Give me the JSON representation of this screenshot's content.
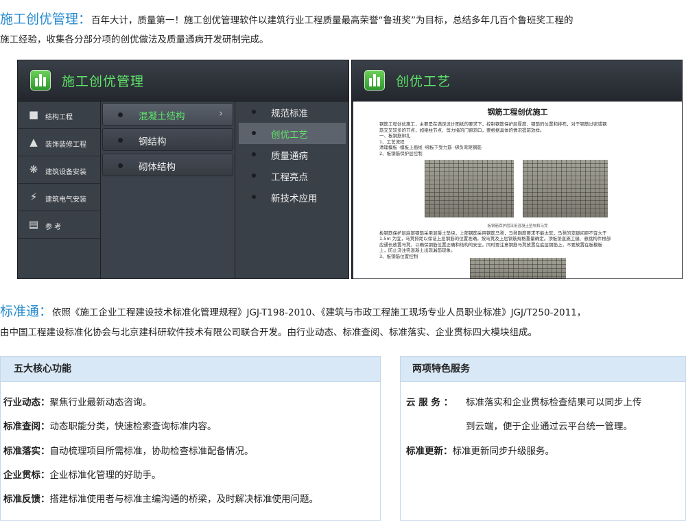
{
  "intro": {
    "title": "施工创优管理：",
    "text_line1": "百年大计，质量第一！施工创优管理软件以建筑行业工程质量最高荣誉“鲁班奖”为目标，总结多年几百个鲁班奖工程的",
    "text_line2": "施工经验，收集各分部分项的创优做法及质量通病开发研制完成。"
  },
  "left_screen": {
    "title": "施工创优管理",
    "col1": [
      {
        "icon": "building-icon",
        "label": "结构工程"
      },
      {
        "icon": "decoration-icon",
        "label": "装饰装修工程"
      },
      {
        "icon": "equipment-icon",
        "label": "建筑设备安装"
      },
      {
        "icon": "electric-icon",
        "label": "建筑电气安装"
      },
      {
        "icon": "reference-icon",
        "label": "参  考"
      }
    ],
    "col2": [
      {
        "label": "混凝土结构",
        "active": true
      },
      {
        "label": "钢结构",
        "active": false
      },
      {
        "label": "砌体结构",
        "active": false
      }
    ],
    "col2_arrow": "›",
    "col3": [
      {
        "label": "规范标准",
        "active": false
      },
      {
        "label": "创优工艺",
        "active": true
      },
      {
        "label": "质量通病",
        "active": false
      },
      {
        "label": "工程亮点",
        "active": false
      },
      {
        "label": "新技术应用",
        "active": false
      }
    ]
  },
  "right_screen": {
    "title": "创优工艺",
    "doc_title": "钢筋工程创优施工",
    "doc_p1": [
      "钢筋工程创优施工，主要是在满足设计图纸的要求下，控制钢筋保护层厚度、钢筋的位置和排布，对于钢筋过密或钢",
      "筋交叉较多的节点，如梁柱节点、剪力墙的门窗洞口，要根据具体的情况提前放样。",
      "一、板钢筋绑扎",
      "1、工艺流程",
      "清理模板  ·模板上画线  ·绑板下受力筋  ·绑负弯矩钢筋",
      "2、板钢筋保护层控制"
    ],
    "photo_caption": "板钢筋保护层采用混凝土垫块和马凳",
    "doc_p2": [
      "板钢筋保护层底部钢筋采用混凝土垫块，上部钢筋采用钢筋马凳，马凳刚度要求不能太软，马凳的支腿间距不宜大于",
      "1.5m 为宜，马凳排距以保证上层钢筋的位置准确，按马凳及上层钢筋规格重量确定。顶板垫直施工缝、悬挑构件根部",
      "应通长放置马凳，以确保钢筋位置正确和结构的安全。同时要注意钢筋马凳放置在底层钢筋上，不要放置在板模板",
      "上，防止浇注完混凝土出现漏筋现象。",
      "3、板钢筋位置控制"
    ]
  },
  "section2": {
    "title": "标准通：",
    "text_line1": "依照《施工企业工程建设技术标准化管理规程》JGJ-T198-2010、《建筑与市政工程施工现场专业人员职业标准》JGJ/T250-2011，",
    "text_line2": "由中国工程建设标准化协会与北京建科研软件技术有限公司联合开发。由行业动态、标准查阅、标准落实、企业贯标四大模块组成。"
  },
  "core_box": {
    "header": "五大核心功能",
    "items": [
      {
        "label": "行业动态：",
        "text": "聚焦行业最新动态咨询。"
      },
      {
        "label": "标准查阅：",
        "text": "动态职能分类，快速检索查询标准内容。"
      },
      {
        "label": "标准落实：",
        "text": "自动梳理项目所需标准，协助检查标准配备情况。"
      },
      {
        "label": "企业贯标：",
        "text": "企业标准化管理的好助手。"
      },
      {
        "label": "标准反馈：",
        "text": "搭建标准使用者与标准主编沟通的桥梁，及时解决标准使用问题。"
      }
    ]
  },
  "service_box": {
    "header": "两项特色服务",
    "cloud_label": "云 服 务 ：",
    "cloud_text1": "标准落实和企业贯标检查结果可以同步上传",
    "cloud_text2": "到云端，便于企业通过云平台统一管理。",
    "update_label": "标准更新：",
    "update_text": "标准更新同步升级服务。"
  }
}
